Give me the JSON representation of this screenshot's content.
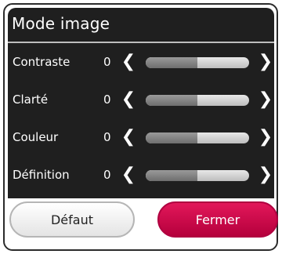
{
  "dialog": {
    "title": "Mode image",
    "settings": [
      {
        "label": "Contraste",
        "value": "0",
        "level": 0.5
      },
      {
        "label": "Clarté",
        "value": "0",
        "level": 0.5
      },
      {
        "label": "Couleur",
        "value": "0",
        "level": 0.5
      },
      {
        "label": "Définition",
        "value": "0",
        "level": 0.5
      }
    ],
    "buttons": {
      "default_label": "Défaut",
      "close_label": "Fermer"
    }
  },
  "colors": {
    "panel_background": "#1f1f1f",
    "accent": "#d60f52"
  },
  "icons": {
    "decrease": "chevron-left-icon",
    "increase": "chevron-right-icon"
  }
}
